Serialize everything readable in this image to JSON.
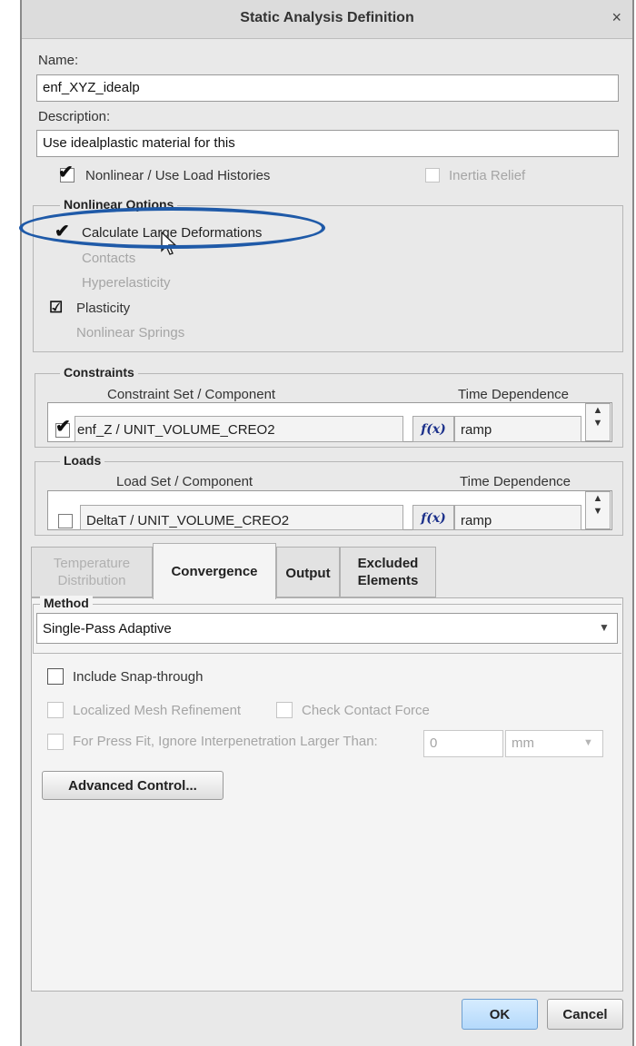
{
  "dialog": {
    "title": "Static Analysis Definition",
    "close_glyph": "×"
  },
  "name": {
    "label": "Name:",
    "value": "enf_XYZ_idealp"
  },
  "description": {
    "label": "Description:",
    "value": "Use idealplastic material for this"
  },
  "options": {
    "nonlinear": {
      "label": "Nonlinear / Use Load Histories",
      "checked": true
    },
    "inertia_relief": {
      "label": "Inertia Relief",
      "checked": false,
      "enabled": false
    }
  },
  "nonlinear_options": {
    "title": "Nonlinear Options",
    "items": [
      {
        "label": "Calculate Large Deformations",
        "checked": true,
        "enabled": true
      },
      {
        "label": "Contacts",
        "enabled": false
      },
      {
        "label": "Hyperelasticity",
        "enabled": false
      },
      {
        "label": "Plasticity",
        "checked": true,
        "enabled": true
      },
      {
        "label": "Nonlinear Springs",
        "enabled": false
      }
    ]
  },
  "constraints": {
    "title": "Constraints",
    "col_set": "Constraint Set / Component",
    "col_time": "Time Dependence",
    "row": {
      "name": "enf_Z / UNIT_VOLUME_CREO2",
      "fx": "f(x)",
      "time": "ramp",
      "checked": true
    }
  },
  "loads": {
    "title": "Loads",
    "col_set": "Load Set / Component",
    "col_time": "Time Dependence",
    "row": {
      "name": "DeltaT / UNIT_VOLUME_CREO2",
      "fx": "f(x)",
      "time": "ramp",
      "checked": false
    }
  },
  "tabs": {
    "temperature": {
      "line1": "Temperature",
      "line2": "Distribution"
    },
    "convergence": "Convergence",
    "output": "Output",
    "excluded": {
      "line1": "Excluded",
      "line2": "Elements"
    }
  },
  "method": {
    "title": "Method",
    "value": "Single-Pass Adaptive"
  },
  "convergence_options": {
    "snap_through": "Include Snap-through",
    "mesh_refinement": "Localized Mesh Refinement",
    "contact_force": "Check Contact Force",
    "press_fit": "For Press Fit, Ignore Interpenetration Larger Than:",
    "press_fit_value": "0",
    "press_fit_unit": "mm"
  },
  "advanced_button": "Advanced Control...",
  "ok_button": "OK",
  "cancel_button": "Cancel",
  "colors": {
    "highlight_ellipse": "#1f5aa8",
    "fx_text": "#1a2f8a"
  }
}
